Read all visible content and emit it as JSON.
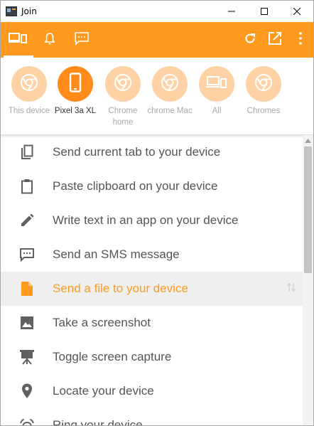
{
  "window": {
    "title": "Join"
  },
  "toolbar": {
    "tabs": [
      {
        "name": "devices",
        "icon": "devices-icon",
        "active": true
      },
      {
        "name": "notifications",
        "icon": "bell-icon",
        "active": false
      },
      {
        "name": "sms",
        "icon": "message-icon",
        "active": false
      }
    ],
    "actions": [
      "refresh-icon",
      "open-external-icon",
      "more-vert-icon"
    ],
    "accent_color": "#ff9a1f"
  },
  "devices": [
    {
      "label": "This device",
      "icon": "chrome-icon",
      "selected": false
    },
    {
      "label": "Pixel 3a XL",
      "icon": "phone-icon",
      "selected": true
    },
    {
      "label": "Chrome home",
      "icon": "chrome-icon",
      "selected": false
    },
    {
      "label": "chrome Mac",
      "icon": "chrome-icon",
      "selected": false
    },
    {
      "label": "All",
      "icon": "devices-icon",
      "selected": false
    },
    {
      "label": "Chromes",
      "icon": "chrome-icon",
      "selected": false
    }
  ],
  "actions": [
    {
      "label": "Send current tab to your device",
      "icon": "copy-icon"
    },
    {
      "label": "Paste clipboard on your device",
      "icon": "clipboard-icon"
    },
    {
      "label": "Write text in an app on your device",
      "icon": "pencil-icon"
    },
    {
      "label": "Send an SMS message",
      "icon": "sms-icon"
    },
    {
      "label": "Send a file to your device",
      "icon": "file-icon",
      "highlighted": true
    },
    {
      "label": "Take a screenshot",
      "icon": "image-icon"
    },
    {
      "label": "Toggle screen capture",
      "icon": "screen-capture-icon"
    },
    {
      "label": "Locate your device",
      "icon": "location-pin-icon"
    },
    {
      "label": "Ring your device",
      "icon": "ring-icon"
    }
  ]
}
